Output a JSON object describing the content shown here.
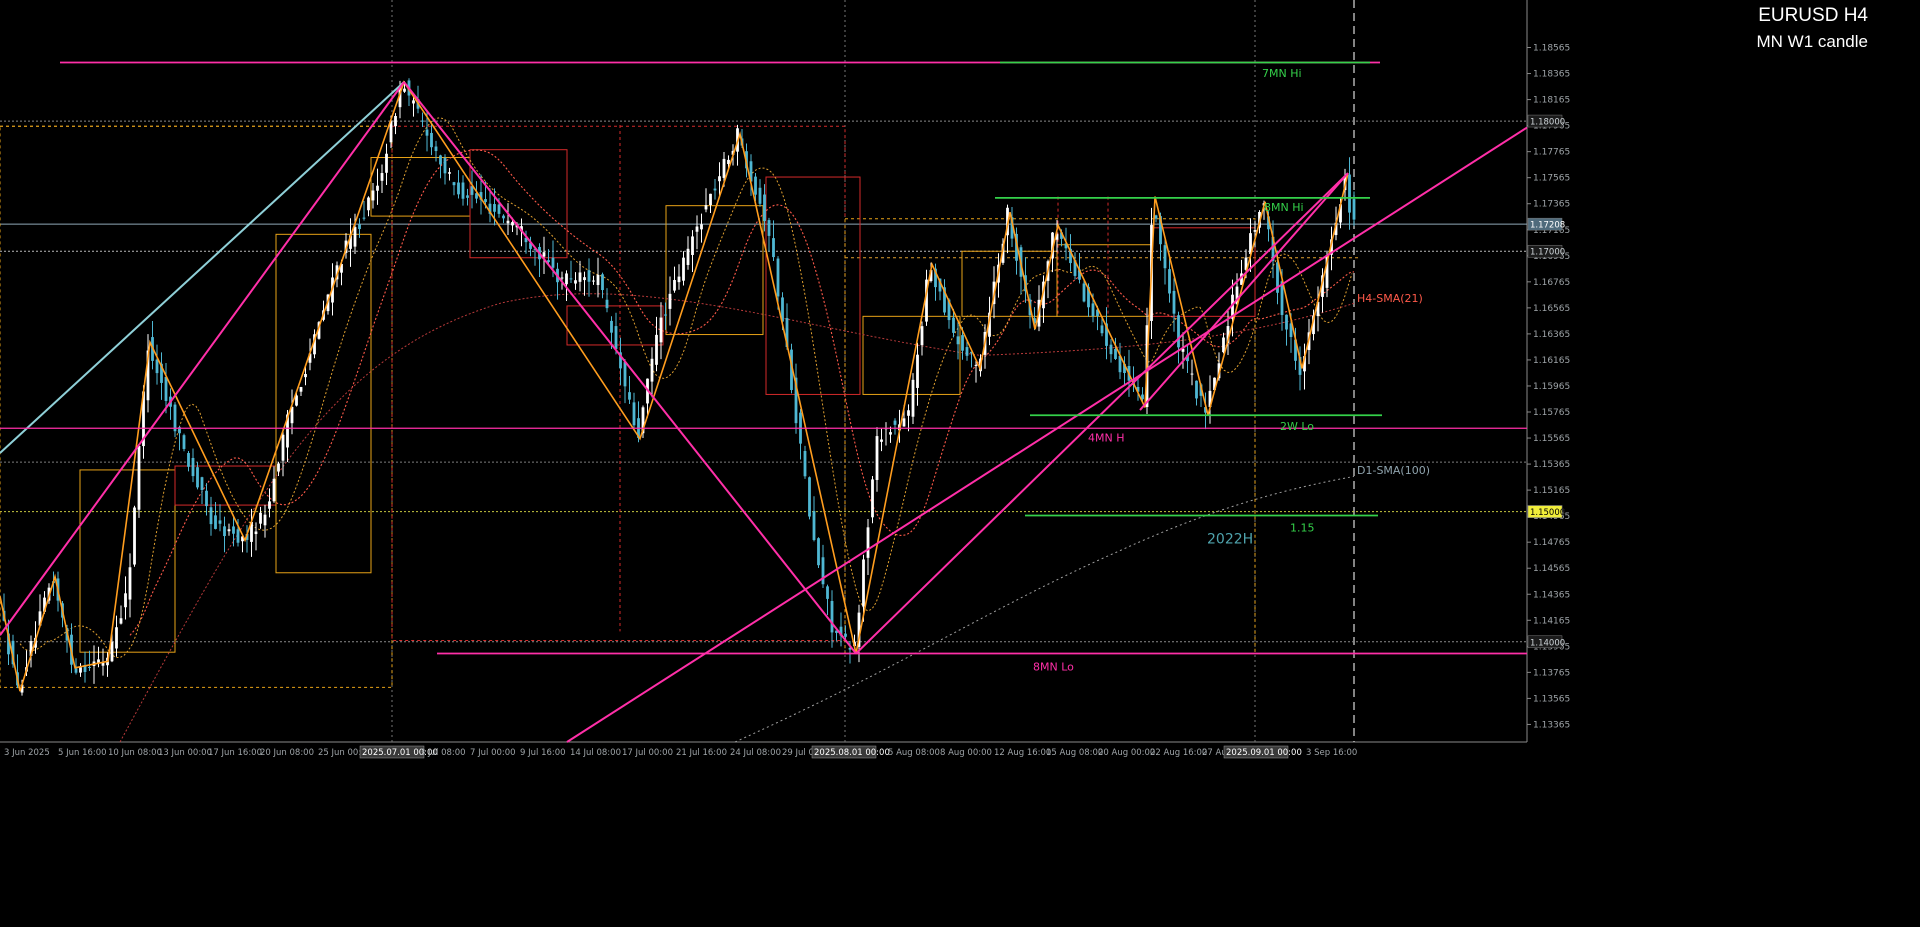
{
  "header": {
    "symbol_timeframe": "EURUSD H4",
    "subtitle": "MN W1 candle"
  },
  "colors": {
    "background": "#000000",
    "bull_candle": "#ffffff",
    "bear_candle": "#4fb7d3",
    "zigzag": "#ff9d1e",
    "trendline": "#ff2fa8",
    "level_green": "#34d14a",
    "htf_box": "#e8a317",
    "htf_box_red": "#d42a2a",
    "grid": "#767676",
    "axis_text": "#9ea4a8"
  },
  "chart_data": {
    "type": "candlestick",
    "title": "EURUSD H4",
    "subtitle": "MN W1 candle",
    "ylim": [
      1.1323,
      1.1893
    ],
    "y_ticks": [
      "1.18565",
      "1.18365",
      "1.18165",
      "1.17965",
      "1.17765",
      "1.17565",
      "1.17365",
      "1.17165",
      "1.16965",
      "1.16765",
      "1.16565",
      "1.16365",
      "1.16165",
      "1.15965",
      "1.15765",
      "1.15565",
      "1.15365",
      "1.15165",
      "1.14965",
      "1.14765",
      "1.14565",
      "1.14365",
      "1.14165",
      "1.13965",
      "1.13765",
      "1.13565",
      "1.13365"
    ],
    "x_ticks": [
      "3 Jun 2025",
      "5 Jun 16:00",
      "10 Jun 08:00",
      "13 Jun 00:00",
      "17 Jun 16:00",
      "20 Jun 08:00",
      "25 Jun 00:00",
      "2025.07.01 00:00",
      "3 Jul 08:00",
      "7 Jul 00:00",
      "9 Jul 16:00",
      "14 Jul 08:00",
      "17 Jul 00:00",
      "21 Jul 16:00",
      "24 Jul 08:00",
      "29 Jul 00:00",
      "2025.08.01 00:00",
      "5 Aug 08:00",
      "8 Aug 00:00",
      "12 Aug 16:00",
      "15 Aug 08:00",
      "20 Aug 00:00",
      "22 Aug 16:00",
      "27 Aug 08:00",
      "2025.09.01 00:00",
      "3 Sep 16:00"
    ],
    "highlighted_x_ticks": [
      "2025.07.01 00:00",
      "2025.08.01 00:00",
      "2025.09.01 00:00"
    ],
    "price_boxes": [
      {
        "label": "1.18000",
        "price": 1.18,
        "style": "dark"
      },
      {
        "label": "1.17208",
        "price": 1.17208,
        "style": "blue"
      },
      {
        "label": "1.17000",
        "price": 1.17,
        "style": "dark"
      },
      {
        "label": "1.15000",
        "price": 1.15,
        "style": "dark"
      },
      {
        "label": "1.15000",
        "price": 1.15,
        "style": "yellow"
      },
      {
        "label": "1.14000",
        "price": 1.14,
        "style": "dark"
      }
    ],
    "levels": [
      {
        "label": "7MN Hi",
        "price": 1.1845,
        "color": "#34d14a"
      },
      {
        "label": "8MN Hi",
        "price": 1.1741,
        "color": "#34d14a"
      },
      {
        "label": "2W Lo",
        "price": 1.1574,
        "color": "#34d14a"
      },
      {
        "label": "4MN H",
        "price": 1.1564,
        "color": "#ff2fa8"
      },
      {
        "label": "1.15",
        "price": 1.1497,
        "color": "#34d14a"
      },
      {
        "label": "8MN Lo",
        "price": 1.1391,
        "color": "#ff2fa8"
      }
    ],
    "annotations": [
      "2022H",
      "D1-SMA(100)",
      "H4-SMA(21)"
    ],
    "anchor_candles": [
      {
        "label": "Jun 3 low",
        "price": 1.136
      },
      {
        "label": "Jun 12 high",
        "price": 1.163
      },
      {
        "label": "Jul 1 high",
        "price": 1.183
      },
      {
        "label": "Jul 17 low",
        "price": 1.1556
      },
      {
        "label": "Jul 24 high",
        "price": 1.179
      },
      {
        "label": "Aug 1 low",
        "price": 1.1391
      },
      {
        "label": "Aug 13 high",
        "price": 1.173
      },
      {
        "label": "Aug 22 low",
        "price": 1.158
      },
      {
        "label": "Aug 22 high",
        "price": 1.1742
      },
      {
        "label": "Aug 27 low",
        "price": 1.1574
      },
      {
        "label": "Aug 29 high",
        "price": 1.1738
      },
      {
        "label": "Sep 2 low",
        "price": 1.161
      },
      {
        "label": "Sep 4 high",
        "price": 1.176
      },
      {
        "label": "Sep 5 last",
        "price": 1.172
      }
    ]
  }
}
